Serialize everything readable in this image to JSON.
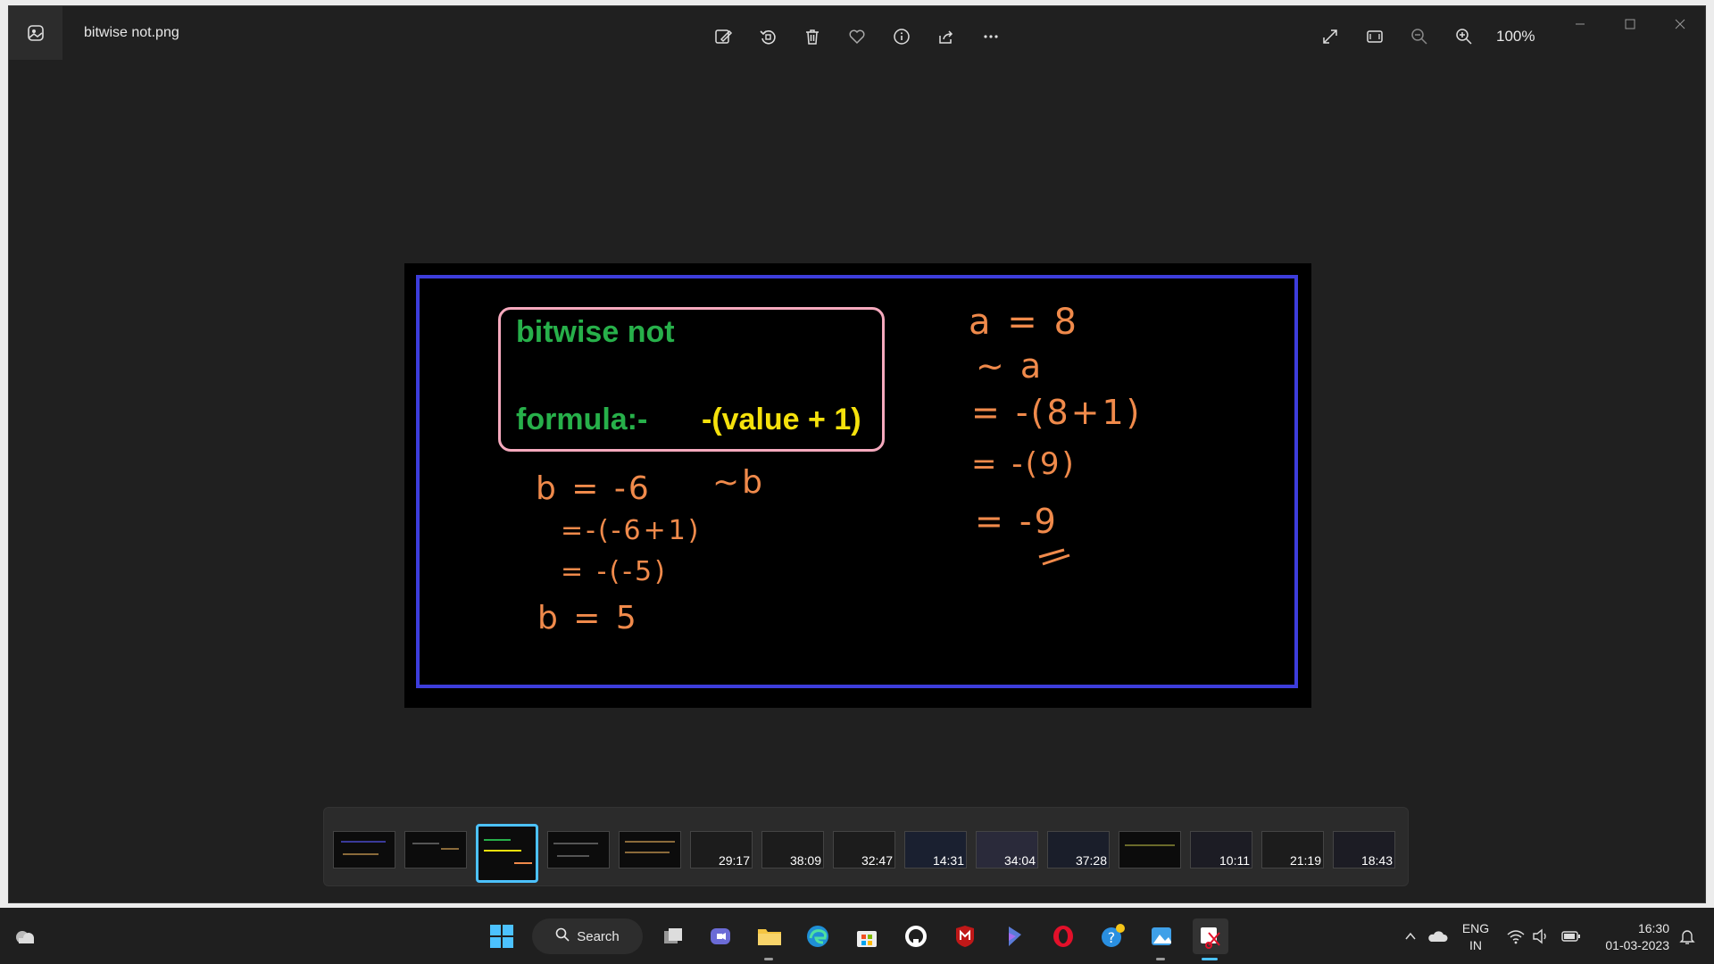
{
  "window": {
    "title": "bitwise not.png",
    "zoom": "100%"
  },
  "toolbar": {
    "icons": [
      "edit-image-icon",
      "rotate-icon",
      "delete-icon",
      "favorite-icon",
      "info-icon",
      "share-icon",
      "more-icon"
    ]
  },
  "view_controls": {
    "icons": [
      "fullscreen-icon",
      "fit-to-window-icon",
      "zoom-out-icon",
      "zoom-in-icon"
    ]
  },
  "slide": {
    "heading": "bitwise not",
    "formula_label": "formula:-",
    "formula_value": "-(value + 1)",
    "left_work": [
      "b = -6",
      "~b",
      "=-(-6+1)",
      "= -(-5)",
      "b = 5"
    ],
    "right_work": [
      "a = 8",
      "~ a",
      "= -(8+1)",
      "= -(9)",
      "= -9"
    ]
  },
  "filmstrip": {
    "durations": [
      "29:17",
      "38:09",
      "32:47",
      "14:31",
      "34:04",
      "37:28",
      "10:11",
      "21:19",
      "18:43"
    ]
  },
  "taskbar": {
    "search_label": "Search",
    "language_top": "ENG",
    "language_bottom": "IN",
    "time": "16:30",
    "date": "01-03-2023"
  }
}
